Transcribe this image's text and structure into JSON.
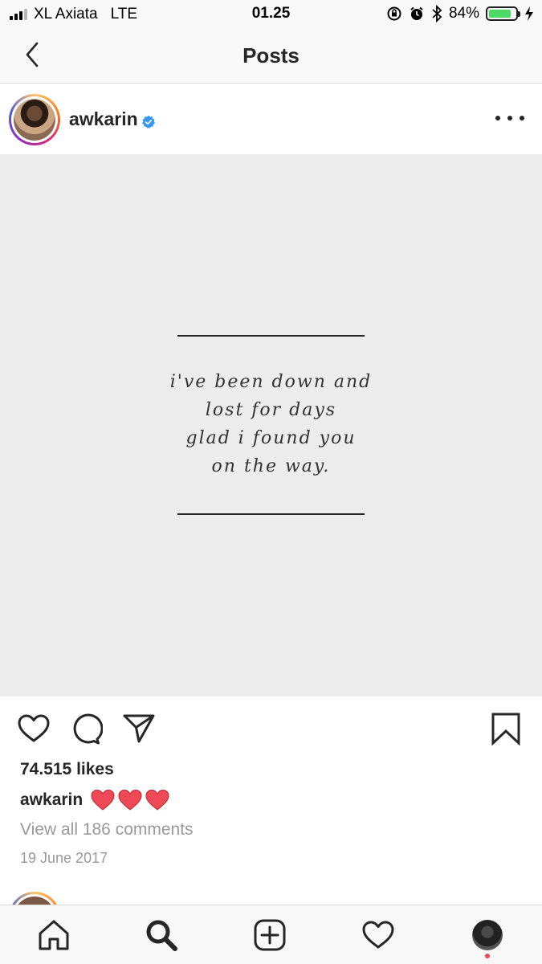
{
  "status_bar": {
    "carrier": "XL Axiata",
    "network": "LTE",
    "time": "01.25",
    "battery": "84%",
    "battery_level": 0.84,
    "icons": [
      "signal-icon",
      "orientation-lock-icon",
      "alarm-icon",
      "bluetooth-icon",
      "battery-icon",
      "charging-icon"
    ]
  },
  "header": {
    "title": "Posts",
    "back_icon": "chevron-left-icon"
  },
  "post": {
    "username": "awkarin",
    "verified": true,
    "quote_lines": [
      "i've been down and",
      "lost for days",
      "glad i found you",
      "on the way."
    ],
    "likes": "74.515 likes",
    "caption_user": "awkarin",
    "caption_hearts": 3,
    "view_comments": "View all 186 comments",
    "date": "19 June 2017"
  },
  "tab_bar": {
    "items": [
      "home-icon",
      "search-icon",
      "add-icon",
      "heart-icon",
      "profile-avatar"
    ]
  },
  "colors": {
    "verified_blue": "#3897f0",
    "heart_red": "#ed4956",
    "text": "#262626",
    "muted": "#999999",
    "image_bg": "#ececec"
  }
}
